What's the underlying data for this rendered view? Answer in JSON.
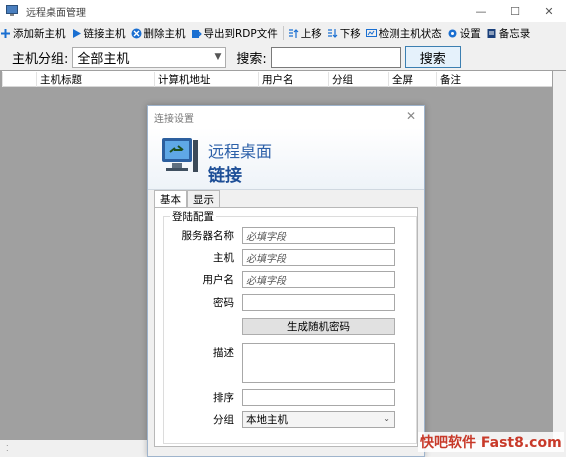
{
  "window": {
    "title": "远程桌面管理",
    "minimize": "—",
    "maximize": "☐",
    "close": "✕"
  },
  "toolbar": {
    "items": [
      {
        "label": "添加新主机",
        "icon": "plus-icon"
      },
      {
        "label": "链接主机",
        "icon": "play-icon"
      },
      {
        "label": "删除主机",
        "icon": "delete-icon"
      },
      {
        "label": "导出到RDP文件",
        "icon": "export-icon"
      },
      {
        "label": "上移",
        "icon": "move-up-icon"
      },
      {
        "label": "下移",
        "icon": "move-down-icon"
      },
      {
        "label": "检测主机状态",
        "icon": "monitor-icon"
      },
      {
        "label": "设置",
        "icon": "gear-icon"
      },
      {
        "label": "备忘录",
        "icon": "memo-icon"
      }
    ]
  },
  "filter": {
    "group_label": "主机分组:",
    "group_value": "全部主机",
    "search_label": "搜索:",
    "search_value": "",
    "search_button": "搜索"
  },
  "table": {
    "columns": [
      "主机标题",
      "计算机地址",
      "用户名",
      "分组",
      "全屏",
      "备注"
    ]
  },
  "dialog": {
    "title": "连接设置",
    "close": "✕",
    "banner_line1": "远程桌面",
    "banner_line2": "链接",
    "tabs": [
      "基本",
      "显示"
    ],
    "group_title": "登陆配置",
    "fields": {
      "server_name_label": "服务器名称",
      "server_name_placeholder": "必填字段",
      "host_label": "主机",
      "host_placeholder": "必填字段",
      "username_label": "用户名",
      "username_placeholder": "必填字段",
      "password_label": "密码",
      "generate_button": "生成随机密码",
      "description_label": "描述",
      "order_label": "排序",
      "group_label": "分组",
      "group_value": "本地主机"
    }
  },
  "watermark": "快吧软件 Fast8.com",
  "colors": {
    "accent": "#2b5fa8",
    "background": "#a0a0a0",
    "watermark": "#c83a2a"
  }
}
